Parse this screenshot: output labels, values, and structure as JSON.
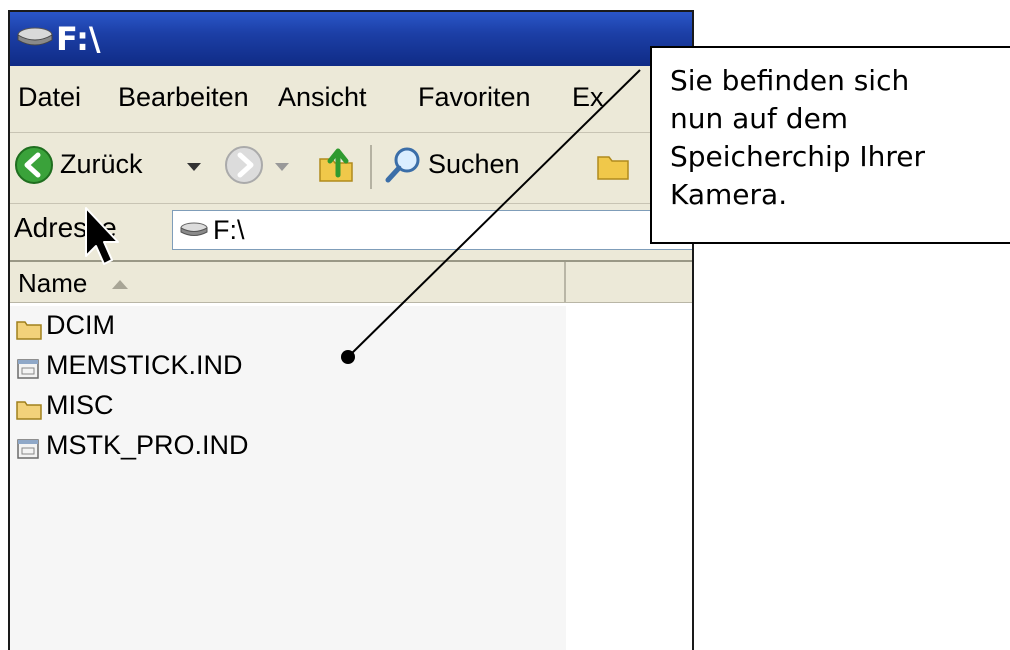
{
  "window": {
    "title": "F:\\"
  },
  "menubar": {
    "items": [
      {
        "label": "Datei"
      },
      {
        "label": "Bearbeiten"
      },
      {
        "label": "Ansicht"
      },
      {
        "label": "Favoriten"
      },
      {
        "label": "Ex"
      }
    ]
  },
  "toolbar": {
    "back_label": "Zurück",
    "search_label": "Suchen"
  },
  "addressbar": {
    "label": "Adresse",
    "value": "F:\\"
  },
  "list": {
    "column_name": "Name"
  },
  "files": [
    {
      "name": "DCIM",
      "icon": "folder-icon"
    },
    {
      "name": "MEMSTICK.IND",
      "icon": "file-icon"
    },
    {
      "name": "MISC",
      "icon": "folder-icon"
    },
    {
      "name": "MSTK_PRO.IND",
      "icon": "file-icon"
    }
  ],
  "callout": {
    "line1": "Sie befinden sich",
    "line2": "nun auf dem",
    "line3": "Speicherchip Ihrer",
    "line4": "Kamera."
  },
  "colors": {
    "titlebar": "#1c3fa6",
    "chrome": "#ece9d8",
    "folder": "#e8c75a"
  }
}
